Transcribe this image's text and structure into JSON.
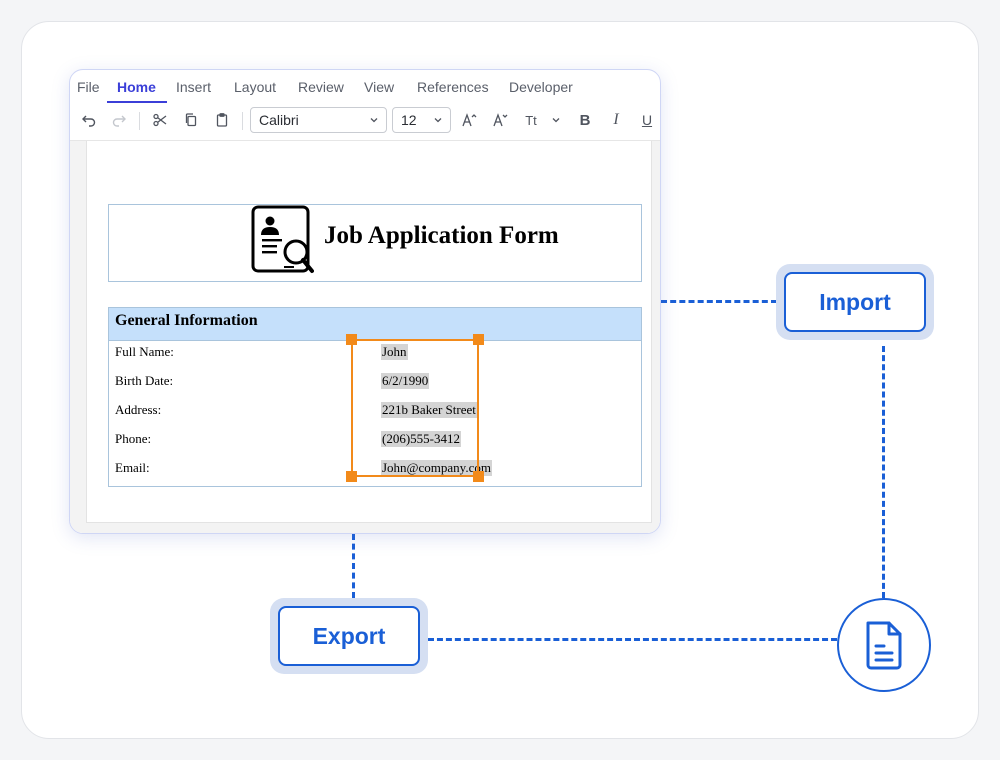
{
  "menu": {
    "items": [
      {
        "label": "File"
      },
      {
        "label": "Home"
      },
      {
        "label": "Insert"
      },
      {
        "label": "Layout"
      },
      {
        "label": "Review"
      },
      {
        "label": "View"
      },
      {
        "label": "References"
      },
      {
        "label": "Developer"
      }
    ],
    "active": "Home"
  },
  "toolbar": {
    "font_family": "Calibri",
    "font_size": "12",
    "icons": [
      "undo-icon",
      "redo-icon",
      "cut-icon",
      "copy-icon",
      "paste-icon",
      "grow-font-icon",
      "shrink-font-icon",
      "change-case-icon",
      "bold-icon",
      "italic-icon",
      "underline-icon"
    ],
    "case_label": "Tt",
    "bold_label": "B",
    "italic_label": "I",
    "underline_label": "U"
  },
  "document": {
    "title": "Job Application Form",
    "section_title": "General Information",
    "fields": [
      {
        "label": "Full Name:",
        "value": "John"
      },
      {
        "label": "Birth Date:",
        "value": "6/2/1990"
      },
      {
        "label": "Address:",
        "value": "221b Baker Street"
      },
      {
        "label": "Phone:",
        "value": "(206)555-3412"
      },
      {
        "label": "Email:",
        "value": "John@company.com"
      }
    ]
  },
  "flow": {
    "import_label": "Import",
    "export_label": "Export",
    "file_icon": "document-icon"
  },
  "colors": {
    "accent": "#1a5fd6",
    "menu_active": "#3b3fd8",
    "selection": "#f28a1a",
    "section_header": "#c5e0fb"
  }
}
